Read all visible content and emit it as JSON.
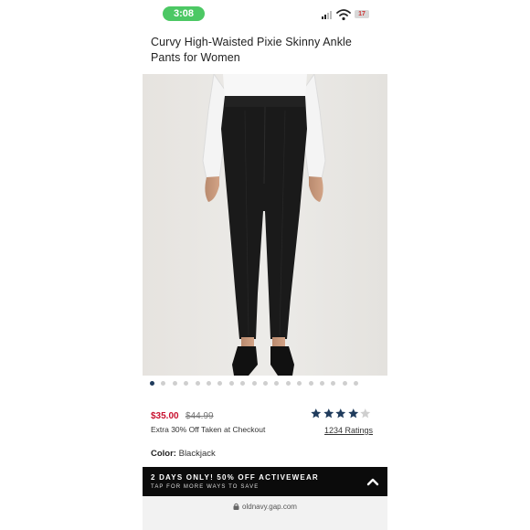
{
  "status_bar": {
    "time": "3:08",
    "battery": "17",
    "icons": [
      "signal-icon",
      "wifi-icon",
      "battery-icon"
    ]
  },
  "product": {
    "title": "Curvy High-Waisted Pixie Skinny Ankle Pants for Women",
    "image_alt": "Model wearing black high-waisted skinny ankle pants with white top and black heels",
    "carousel": {
      "count": 19,
      "active_index": 0
    },
    "sale_price": "$35.00",
    "original_price": "$44.99",
    "promo": "Extra 30% Off Taken at Checkout",
    "rating": {
      "stars": 4,
      "max": 5,
      "count_label": "1234 Ratings"
    },
    "color_label": "Color:",
    "color_value": "Blackjack"
  },
  "banner": {
    "headline": "2 DAYS ONLY! 50% OFF ACTIVEWEAR",
    "subline": "TAP FOR MORE WAYS TO SAVE",
    "icon": "chevron-up-icon"
  },
  "browser": {
    "url": "oldnavy.gap.com",
    "icon": "lock-icon"
  },
  "colors": {
    "accent_navy": "#1f3b5c",
    "sale_red": "#c8102e",
    "status_green": "#4cc864",
    "banner_bg": "#0b0b0b"
  }
}
